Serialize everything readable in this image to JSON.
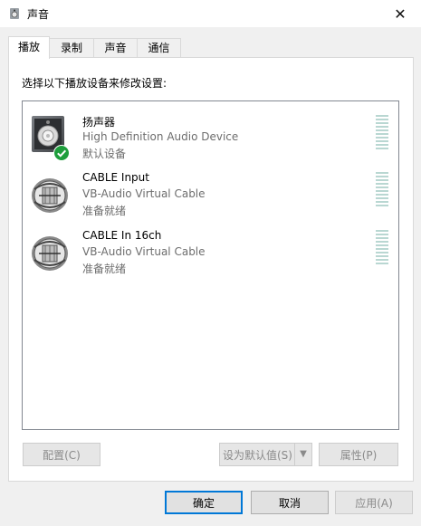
{
  "window": {
    "title": "声音",
    "close_glyph": "✕"
  },
  "tabs": [
    {
      "label": "播放",
      "active": true
    },
    {
      "label": "录制",
      "active": false
    },
    {
      "label": "声音",
      "active": false
    },
    {
      "label": "通信",
      "active": false
    }
  ],
  "instruction": "选择以下播放设备来修改设置:",
  "devices": [
    {
      "name": "扬声器",
      "description": "High Definition Audio Device",
      "status": "默认设备",
      "icon": "speaker-icon",
      "default": true
    },
    {
      "name": "CABLE Input",
      "description": "VB-Audio Virtual Cable",
      "status": "准备就绪",
      "icon": "cable-icon",
      "default": false
    },
    {
      "name": "CABLE In 16ch",
      "description": "VB-Audio Virtual Cable",
      "status": "准备就绪",
      "icon": "cable-icon",
      "default": false
    }
  ],
  "panel_buttons": {
    "configure": "配置(C)",
    "set_default": "设为默认值(S)",
    "properties": "属性(P)"
  },
  "footer_buttons": {
    "ok": "确定",
    "cancel": "取消",
    "apply": "应用(A)"
  },
  "colors": {
    "accent": "#0078d7",
    "check": "#1e9e3c",
    "meter": "#b9d7d2"
  }
}
